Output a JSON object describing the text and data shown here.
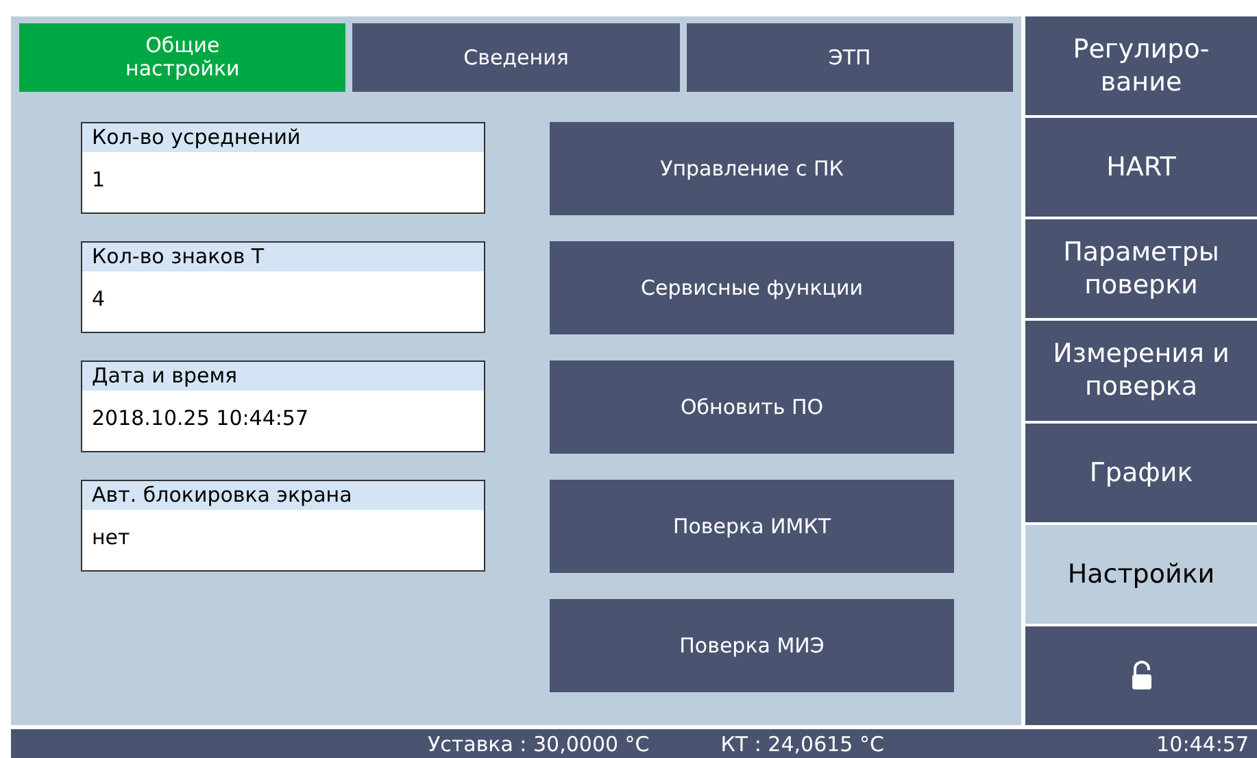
{
  "tabs": [
    {
      "label": "Общие\nнастройки",
      "selected": true
    },
    {
      "label": "Сведения",
      "selected": false
    },
    {
      "label": "ЭТП",
      "selected": false
    }
  ],
  "fields": [
    {
      "label": "Кол-во усреднений",
      "value": "1"
    },
    {
      "label": "Кол-во знаков Т",
      "value": "4"
    },
    {
      "label": "Дата и время",
      "value": "2018.10.25 10:44:57"
    },
    {
      "label": "Авт. блокировка экрана",
      "value": "нет"
    }
  ],
  "buttons": [
    "Управление с ПК",
    "Сервисные функции",
    "Обновить ПО",
    "Поверка ИМКТ",
    "Поверка МИЭ"
  ],
  "sidebar": {
    "items": [
      {
        "kind": "text",
        "label": "Регулиро-\nвание",
        "selected": false
      },
      {
        "kind": "text",
        "label": "HART",
        "selected": false
      },
      {
        "kind": "text",
        "label": "Параметры\nповерки",
        "selected": false
      },
      {
        "kind": "text",
        "label": "Измерения и\nповерка",
        "selected": false
      },
      {
        "kind": "text",
        "label": "График",
        "selected": false
      },
      {
        "kind": "text",
        "label": "Настройки",
        "selected": true
      },
      {
        "kind": "lock",
        "selected": false
      }
    ]
  },
  "status_bar": {
    "setpoint": "Уставка : 30,0000 °C",
    "kt": "КТ : 24,0615 °C",
    "time": "10:44:57"
  }
}
